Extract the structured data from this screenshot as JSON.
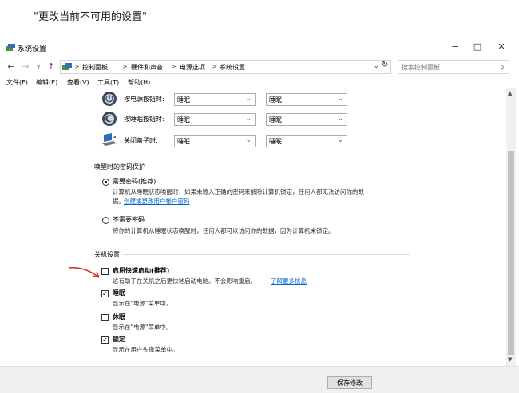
{
  "caption": "\"更改当前不可用的设置\"",
  "window": {
    "title": "系统设置",
    "icon": "power-options-icon",
    "controls": {
      "minimize": "−",
      "maximize": "□",
      "close": "✕"
    }
  },
  "address": {
    "breadcrumbs": [
      "控制面板",
      "硬件和声音",
      "电源选项",
      "系统设置"
    ],
    "separator": ">",
    "search_placeholder": "搜索控制面板"
  },
  "menu": [
    "文件(F)",
    "编辑(E)",
    "查看(V)",
    "工具(T)",
    "帮助(H)"
  ],
  "power_buttons": [
    {
      "label": "按电源按钮时:",
      "icon": "power-button-icon",
      "battery": "睡眠",
      "plugged": "睡眠"
    },
    {
      "label": "按睡眠按钮时:",
      "icon": "sleep-button-icon",
      "battery": "睡眠",
      "plugged": "睡眠"
    },
    {
      "label": "关闭盖子时:",
      "icon": "laptop-lid-icon",
      "battery": "睡眠",
      "plugged": "睡眠"
    }
  ],
  "password": {
    "title": "唤醒时的密码保护",
    "require": {
      "title": "需要密码(推荐)",
      "desc": "计算机从睡眠状态唤醒时，如果未输入正确的密码来解除计算机锁定，任何人都无法访问你的数",
      "desc2": "据。",
      "link": "创建或更改用户帐户密码",
      "selected": true
    },
    "no_require": {
      "title": "不需要密码",
      "desc": "将你的计算机从睡眠状态唤醒时，任何人都可以访问你的数据，因为计算机未锁定。",
      "selected": false
    }
  },
  "shutdown": {
    "title": "关机设置",
    "options": [
      {
        "title": "启用快速启动(推荐)",
        "desc": "这有助于在关机之后更快地启动电脑。不会影响重启。",
        "link": "了解更多信息",
        "checked": false
      },
      {
        "title": "睡眠",
        "desc": "显示在\"电源\"菜单中。",
        "checked": true
      },
      {
        "title": "休眠",
        "desc": "显示在\"电源\"菜单中。",
        "checked": false
      },
      {
        "title": "锁定",
        "desc": "显示在用户头像菜单中。",
        "checked": true
      }
    ]
  },
  "footer": {
    "save_label": "保存修改"
  },
  "annotation": {
    "color": "#e02020"
  },
  "colors": {
    "link": "#0066cc",
    "footer_bg": "#f0f0f0"
  }
}
